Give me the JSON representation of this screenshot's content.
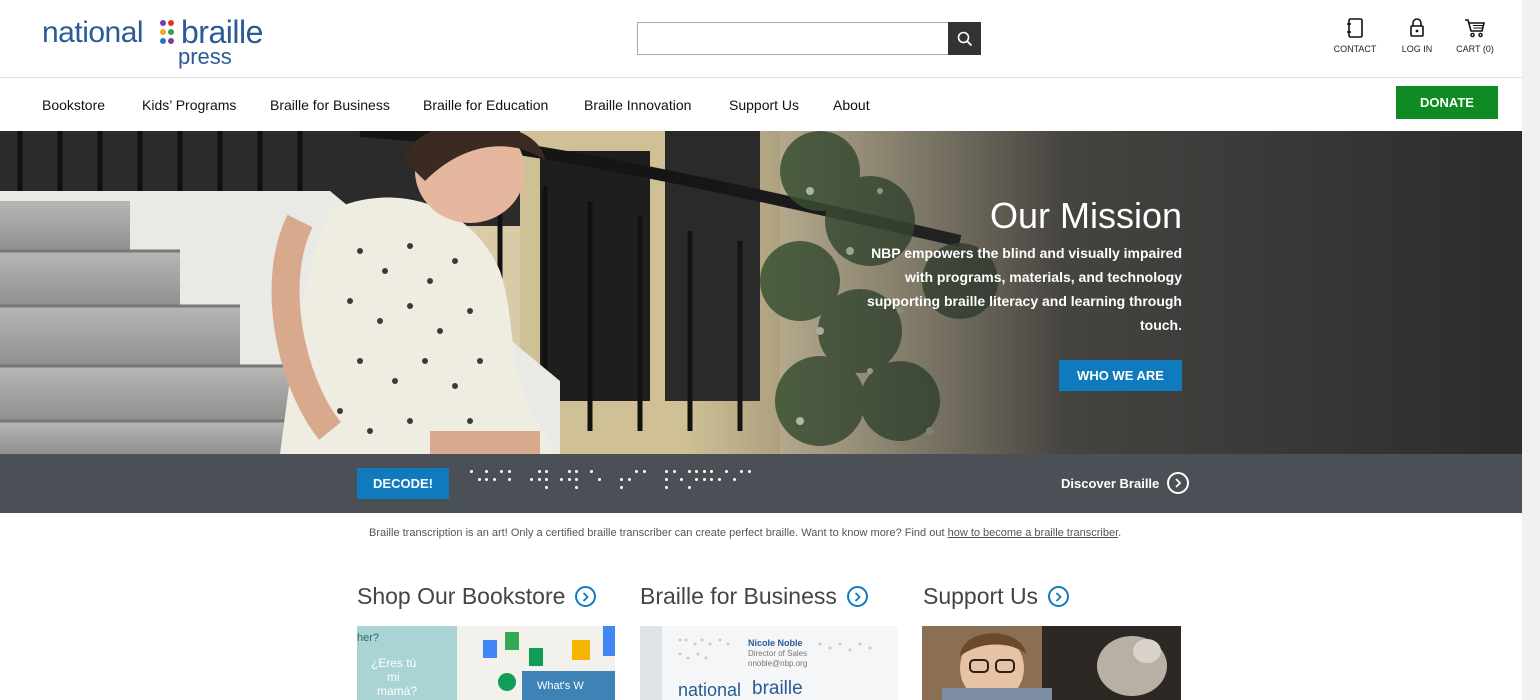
{
  "header": {
    "logo": {
      "word1": "national",
      "word2": "braille",
      "word3": "press",
      "dot_colors": [
        "#7a3ba0",
        "#d93b2b",
        "#f2a81d",
        "#3aa04a",
        "#1f7bc0",
        "#7a3ba0"
      ]
    },
    "search": {
      "value": "",
      "placeholder": "",
      "icon": "search-icon"
    },
    "utility": [
      {
        "label": "CONTACT",
        "icon": "address-book-icon"
      },
      {
        "label": "LOG IN",
        "icon": "lock-icon"
      },
      {
        "label": "CART (0)",
        "icon": "cart-icon"
      }
    ]
  },
  "nav": {
    "items": [
      "Bookstore",
      "Kids’ Programs",
      "Braille for Business",
      "Braille for Education",
      "Braille Innovation",
      "Support Us",
      "About"
    ],
    "donate_label": "DONATE"
  },
  "hero": {
    "title": "Our Mission",
    "description": "NBP empowers the blind and visually impaired with programs, materials, and technology supporting braille literacy and learning through touch.",
    "cta_label": "WHO WE ARE"
  },
  "decode": {
    "button_label": "DECODE!",
    "discover_label": "Discover Braille",
    "braille_cells": [
      [
        1,
        5
      ],
      [
        1,
        2,
        5
      ],
      [
        1,
        4,
        5
      ],
      [],
      [
        2,
        4,
        5
      ],
      [
        1,
        2,
        3
      ],
      [
        2,
        4,
        5
      ],
      [
        1,
        2,
        3
      ],
      [
        1,
        5
      ],
      [],
      [
        2,
        3,
        5
      ],
      [
        1,
        4
      ],
      [],
      [
        1,
        2,
        3,
        4
      ],
      [
        2,
        4,
        6
      ],
      [
        1,
        2,
        4,
        5
      ],
      [
        1,
        2,
        5
      ],
      [
        1,
        5
      ],
      [
        1,
        4
      ]
    ]
  },
  "notice": {
    "text": "Braille transcription is an art! Only a certified braille transcriber can create perfect braille. Want to know more? Find out ",
    "link_text": "how to become a braille transcriber",
    "suffix": "."
  },
  "sections": [
    {
      "title": "Shop Our Bookstore",
      "icon": "chevron-right-circle-icon"
    },
    {
      "title": "Braille for Business",
      "icon": "chevron-right-circle-icon",
      "card_text": [
        "Nicole Noble",
        "Director of Sales",
        "nnoble@nbp.org",
        "national",
        "braille"
      ]
    },
    {
      "title": "Support Us",
      "icon": "chevron-right-circle-icon"
    }
  ],
  "bookstore_card_text": [
    "her?",
    "¿Eres tú",
    "mi",
    "mamá?",
    "What's W"
  ],
  "colors": {
    "brand": "#2a5a97",
    "accent": "#0f7bbe",
    "donate": "#108a22",
    "band": "#4b4f56"
  }
}
